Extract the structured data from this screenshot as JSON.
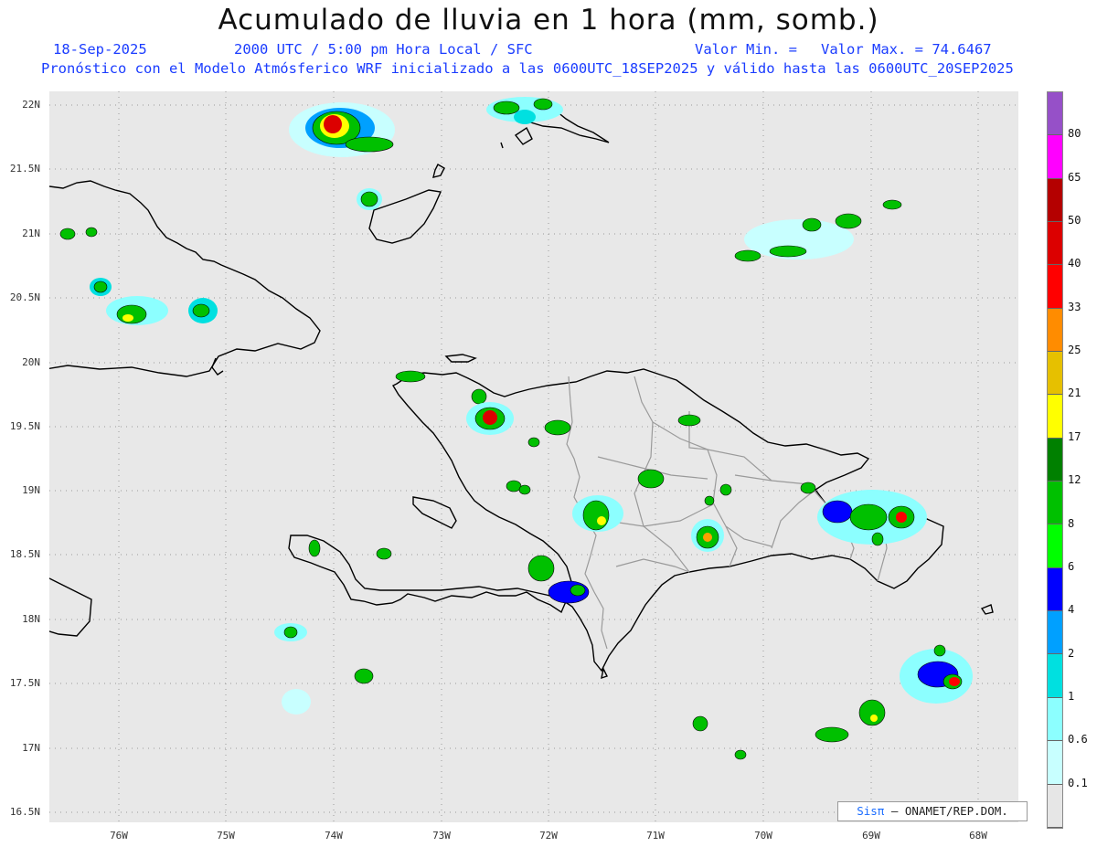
{
  "header": {
    "title": "Acumulado de lluvia en 1 hora (mm, somb.)",
    "date": "18-Sep-2025",
    "time": "2000 UTC / 5:00 pm Hora Local / SFC",
    "min_label": "Valor Min. =",
    "max_label": "Valor Max. = 74.6467",
    "model_line": "Pronóstico con el Modelo Atmósferico WRF inicializado a las 0600UTC_18SEP2025 y válido hasta las  0600UTC_20SEP2025"
  },
  "map": {
    "lat_labels": [
      "22N",
      "21.5N",
      "21N",
      "20.5N",
      "20N",
      "19.5N",
      "19N",
      "18.5N",
      "18N",
      "17.5N",
      "17N",
      "16.5N"
    ],
    "lon_labels": [
      "76W",
      "75W",
      "74W",
      "73W",
      "72W",
      "71W",
      "70W",
      "69W",
      "68W"
    ],
    "credit_brand": "Sisπ",
    "credit_text": "– ONAMET/REP.DOM."
  },
  "colorbar": {
    "levels": [
      "0.1",
      "0.6",
      "1",
      "2",
      "4",
      "6",
      "8",
      "12",
      "17",
      "21",
      "25",
      "33",
      "40",
      "50",
      "65",
      "80"
    ],
    "colors": [
      "#e6e6e6",
      "#c8ffff",
      "#8cffff",
      "#00e0e0",
      "#00a0ff",
      "#0000ff",
      "#00ff00",
      "#00c000",
      "#008000",
      "#ffff00",
      "#e6c000",
      "#ff8c00",
      "#ff0000",
      "#dc0000",
      "#b40000",
      "#ff00ff",
      "#9650c8"
    ]
  }
}
